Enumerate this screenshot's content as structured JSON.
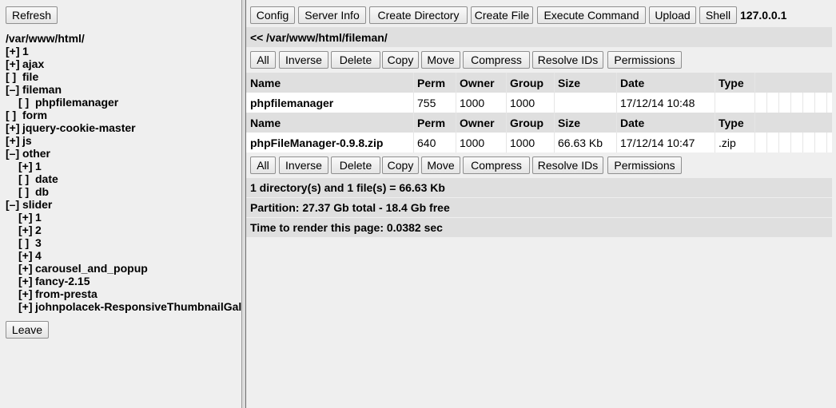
{
  "left_panel": {
    "refresh_label": "Refresh",
    "leave_label": "Leave",
    "tree_root": "/var/www/html/",
    "tree_items": [
      {
        "marker": "[+]",
        "label": "1"
      },
      {
        "marker": "[+]",
        "label": "ajax"
      },
      {
        "marker": "[ ]",
        "label": "file"
      },
      {
        "marker": "[–]",
        "label": "fileman"
      },
      {
        "marker": "[ ]",
        "label": "phpfilemanager"
      },
      {
        "marker": "[ ]",
        "label": "form"
      },
      {
        "marker": "[+]",
        "label": "jquery-cookie-master"
      },
      {
        "marker": "[+]",
        "label": "js"
      },
      {
        "marker": "[–]",
        "label": "other"
      },
      {
        "marker": "[+]",
        "label": "1"
      },
      {
        "marker": "[ ]",
        "label": "date"
      },
      {
        "marker": "[ ]",
        "label": "db"
      },
      {
        "marker": "[–]",
        "label": "slider"
      },
      {
        "marker": "[+]",
        "label": "1"
      },
      {
        "marker": "[+]",
        "label": "2"
      },
      {
        "marker": "[ ]",
        "label": "3"
      },
      {
        "marker": "[+]",
        "label": "4"
      },
      {
        "marker": "[+]",
        "label": "carousel_and_popup"
      },
      {
        "marker": "[+]",
        "label": "fancy-2.15"
      },
      {
        "marker": "[+]",
        "label": "from-presta"
      },
      {
        "marker": "[+]",
        "label": "johnpolacek-ResponsiveThumbnailGallery"
      }
    ]
  },
  "toolbar": {
    "buttons": [
      "Config",
      "Server Info",
      "Create Directory",
      "Create File",
      "Execute Command",
      "Upload",
      "Shell"
    ],
    "host": "127.0.0.1"
  },
  "path": {
    "up": "<<",
    "current": "/var/www/html/fileman/"
  },
  "actions": [
    "All",
    "Inverse",
    "Delete",
    "Copy",
    "Move",
    "Compress",
    "Resolve IDs",
    "Permissions"
  ],
  "table": {
    "columns": [
      "Name",
      "Perm",
      "Owner",
      "Group",
      "Size",
      "Date",
      "Type"
    ],
    "directory": {
      "name": "phpfilemanager",
      "perm": "755",
      "owner": "1000",
      "group": "1000",
      "size": "",
      "date": "17/12/14 10:48",
      "type": ""
    },
    "file": {
      "name": "phpFileManager-0.9.8.zip",
      "perm": "640",
      "owner": "1000",
      "group": "1000",
      "size": "66.63 Kb",
      "date": "17/12/14 10:47",
      "type": ".zip"
    }
  },
  "status": {
    "summary": "1 directory(s) and 1 file(s) = 66.63 Kb",
    "partition": "Partition: 27.37 Gb total - 18.4 Gb free",
    "render_time": "Time to render this page: 0.0382 sec"
  }
}
